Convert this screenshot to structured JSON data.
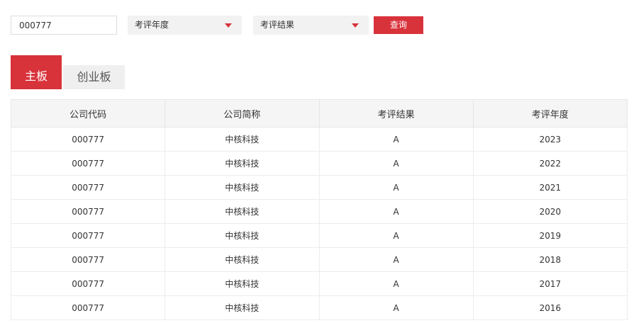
{
  "filter": {
    "code_value": "000777",
    "year_select": "考评年度",
    "result_select": "考评结果",
    "query_label": "查询"
  },
  "tabs": [
    {
      "label": "主板",
      "active": true
    },
    {
      "label": "创业板",
      "active": false
    }
  ],
  "table": {
    "headers": [
      "公司代码",
      "公司简称",
      "考评结果",
      "考评年度"
    ],
    "rows": [
      [
        "000777",
        "中核科技",
        "A",
        "2023"
      ],
      [
        "000777",
        "中核科技",
        "A",
        "2022"
      ],
      [
        "000777",
        "中核科技",
        "A",
        "2021"
      ],
      [
        "000777",
        "中核科技",
        "A",
        "2020"
      ],
      [
        "000777",
        "中核科技",
        "A",
        "2019"
      ],
      [
        "000777",
        "中核科技",
        "A",
        "2018"
      ],
      [
        "000777",
        "中核科技",
        "A",
        "2017"
      ],
      [
        "000777",
        "中核科技",
        "A",
        "2016"
      ]
    ]
  },
  "colors": {
    "accent": "#d8323b",
    "select_bg": "#f2f2f2",
    "header_bg": "#f5f5f5"
  },
  "icons": {
    "select_caret": "caret-down-icon"
  }
}
